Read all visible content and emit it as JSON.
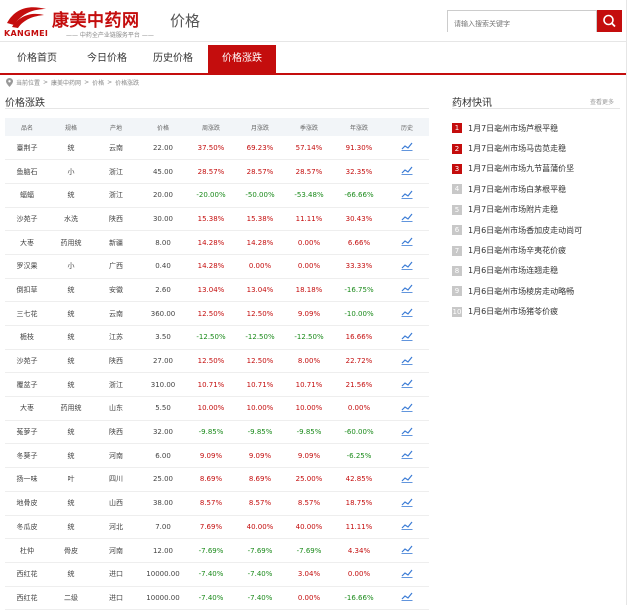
{
  "header": {
    "brand": "康美中药网",
    "brand_en": "KANGMEI",
    "slogan": "—— 中药全产业链服务平台 ——",
    "page_name": "价格",
    "search_placeholder": "请输入搜索关键字",
    "accent_color": "#c40d0d"
  },
  "nav": {
    "tabs": [
      {
        "label": "价格首页"
      },
      {
        "label": "今日价格"
      },
      {
        "label": "历史价格"
      },
      {
        "label": "价格涨跌",
        "active": true
      }
    ]
  },
  "breadcrumb": {
    "items": [
      "当前位置",
      "康美中药网",
      "价格",
      "价格涨跌"
    ],
    "separator": ">"
  },
  "left": {
    "title": "价格涨跌"
  },
  "right": {
    "title": "药材快讯",
    "more": "查看更多"
  },
  "table": {
    "headers": [
      "品名",
      "规格",
      "产地",
      "价格",
      "周涨跌",
      "月涨跌",
      "季涨跌",
      "年涨跌",
      "历史"
    ],
    "rows": [
      {
        "name": "臺荆子",
        "spec": "统",
        "origin": "云南",
        "price": "22.00",
        "week": "37.50%",
        "month": "69.23%",
        "quarter": "57.14%",
        "year": "91.30%"
      },
      {
        "name": "鱼脑石",
        "spec": "小",
        "origin": "浙江",
        "price": "45.00",
        "week": "28.57%",
        "month": "28.57%",
        "quarter": "28.57%",
        "year": "32.35%"
      },
      {
        "name": "蝠蝠",
        "spec": "统",
        "origin": "浙江",
        "price": "20.00",
        "week": "-20.00%",
        "month": "-50.00%",
        "quarter": "-53.48%",
        "year": "-66.66%"
      },
      {
        "name": "沙苑子",
        "spec": "水洗",
        "origin": "陕西",
        "price": "30.00",
        "week": "15.38%",
        "month": "15.38%",
        "quarter": "11.11%",
        "year": "30.43%"
      },
      {
        "name": "大枣",
        "spec": "药用统",
        "origin": "新疆",
        "price": "8.00",
        "week": "14.28%",
        "month": "14.28%",
        "quarter": "0.00%",
        "year": "6.66%"
      },
      {
        "name": "罗汉果",
        "spec": "小",
        "origin": "广西",
        "price": "0.40",
        "week": "14.28%",
        "month": "0.00%",
        "quarter": "0.00%",
        "year": "33.33%"
      },
      {
        "name": "倒扣草",
        "spec": "统",
        "origin": "安徽",
        "price": "2.60",
        "week": "13.04%",
        "month": "13.04%",
        "quarter": "18.18%",
        "year": "-16.75%"
      },
      {
        "name": "三七花",
        "spec": "统",
        "origin": "云南",
        "price": "360.00",
        "week": "12.50%",
        "month": "12.50%",
        "quarter": "9.09%",
        "year": "-10.00%"
      },
      {
        "name": "栀枝",
        "spec": "统",
        "origin": "江苏",
        "price": "3.50",
        "week": "-12.50%",
        "month": "-12.50%",
        "quarter": "-12.50%",
        "year": "16.66%"
      },
      {
        "name": "沙苑子",
        "spec": "统",
        "origin": "陕西",
        "price": "27.00",
        "week": "12.50%",
        "month": "12.50%",
        "quarter": "8.00%",
        "year": "22.72%"
      },
      {
        "name": "覆盆子",
        "spec": "统",
        "origin": "浙江",
        "price": "310.00",
        "week": "10.71%",
        "month": "10.71%",
        "quarter": "10.71%",
        "year": "21.56%"
      },
      {
        "name": "大枣",
        "spec": "药用统",
        "origin": "山东",
        "price": "5.50",
        "week": "10.00%",
        "month": "10.00%",
        "quarter": "10.00%",
        "year": "0.00%"
      },
      {
        "name": "菟萝子",
        "spec": "统",
        "origin": "陕西",
        "price": "32.00",
        "week": "-9.85%",
        "month": "-9.85%",
        "quarter": "-9.85%",
        "year": "-60.00%"
      },
      {
        "name": "冬葵子",
        "spec": "统",
        "origin": "河南",
        "price": "6.00",
        "week": "9.09%",
        "month": "9.09%",
        "quarter": "9.09%",
        "year": "-6.25%"
      },
      {
        "name": "扬一味",
        "spec": "叶",
        "origin": "四川",
        "price": "25.00",
        "week": "8.69%",
        "month": "8.69%",
        "quarter": "25.00%",
        "year": "42.85%"
      },
      {
        "name": "地骨皮",
        "spec": "统",
        "origin": "山西",
        "price": "38.00",
        "week": "8.57%",
        "month": "8.57%",
        "quarter": "8.57%",
        "year": "18.75%"
      },
      {
        "name": "冬瓜皮",
        "spec": "统",
        "origin": "河北",
        "price": "7.00",
        "week": "7.69%",
        "month": "40.00%",
        "quarter": "40.00%",
        "year": "11.11%"
      },
      {
        "name": "杜仲",
        "spec": "骨皮",
        "origin": "河南",
        "price": "12.00",
        "week": "-7.69%",
        "month": "-7.69%",
        "quarter": "-7.69%",
        "year": "4.34%"
      },
      {
        "name": "西红花",
        "spec": "统",
        "origin": "进口",
        "price": "10000.00",
        "week": "-7.40%",
        "month": "-7.40%",
        "quarter": "3.04%",
        "year": "0.00%"
      },
      {
        "name": "西红花",
        "spec": "二级",
        "origin": "进口",
        "price": "10000.00",
        "week": "-7.40%",
        "month": "-7.40%",
        "quarter": "0.00%",
        "year": "-16.66%"
      }
    ]
  },
  "news": {
    "items": [
      {
        "rank": "1",
        "text": "1月7日亳州市场芦根平稳"
      },
      {
        "rank": "2",
        "text": "1月7日亳州市场马齿苋走稳"
      },
      {
        "rank": "3",
        "text": "1月7日亳州市场九节菖蒲价坚"
      },
      {
        "rank": "4",
        "text": "1月7日亳州市场白茅根平稳"
      },
      {
        "rank": "5",
        "text": "1月7日亳州市场附片走稳"
      },
      {
        "rank": "6",
        "text": "1月6日亳州市场香加皮走动尚可"
      },
      {
        "rank": "7",
        "text": "1月6日亳州市场辛夷花价疲"
      },
      {
        "rank": "8",
        "text": "1月6日亳州市场连翘走稳"
      },
      {
        "rank": "9",
        "text": "1月6日亳州市场棱房走动略畅"
      },
      {
        "rank": "10",
        "text": "1月6日亳州市场猪苓价疲"
      }
    ]
  }
}
